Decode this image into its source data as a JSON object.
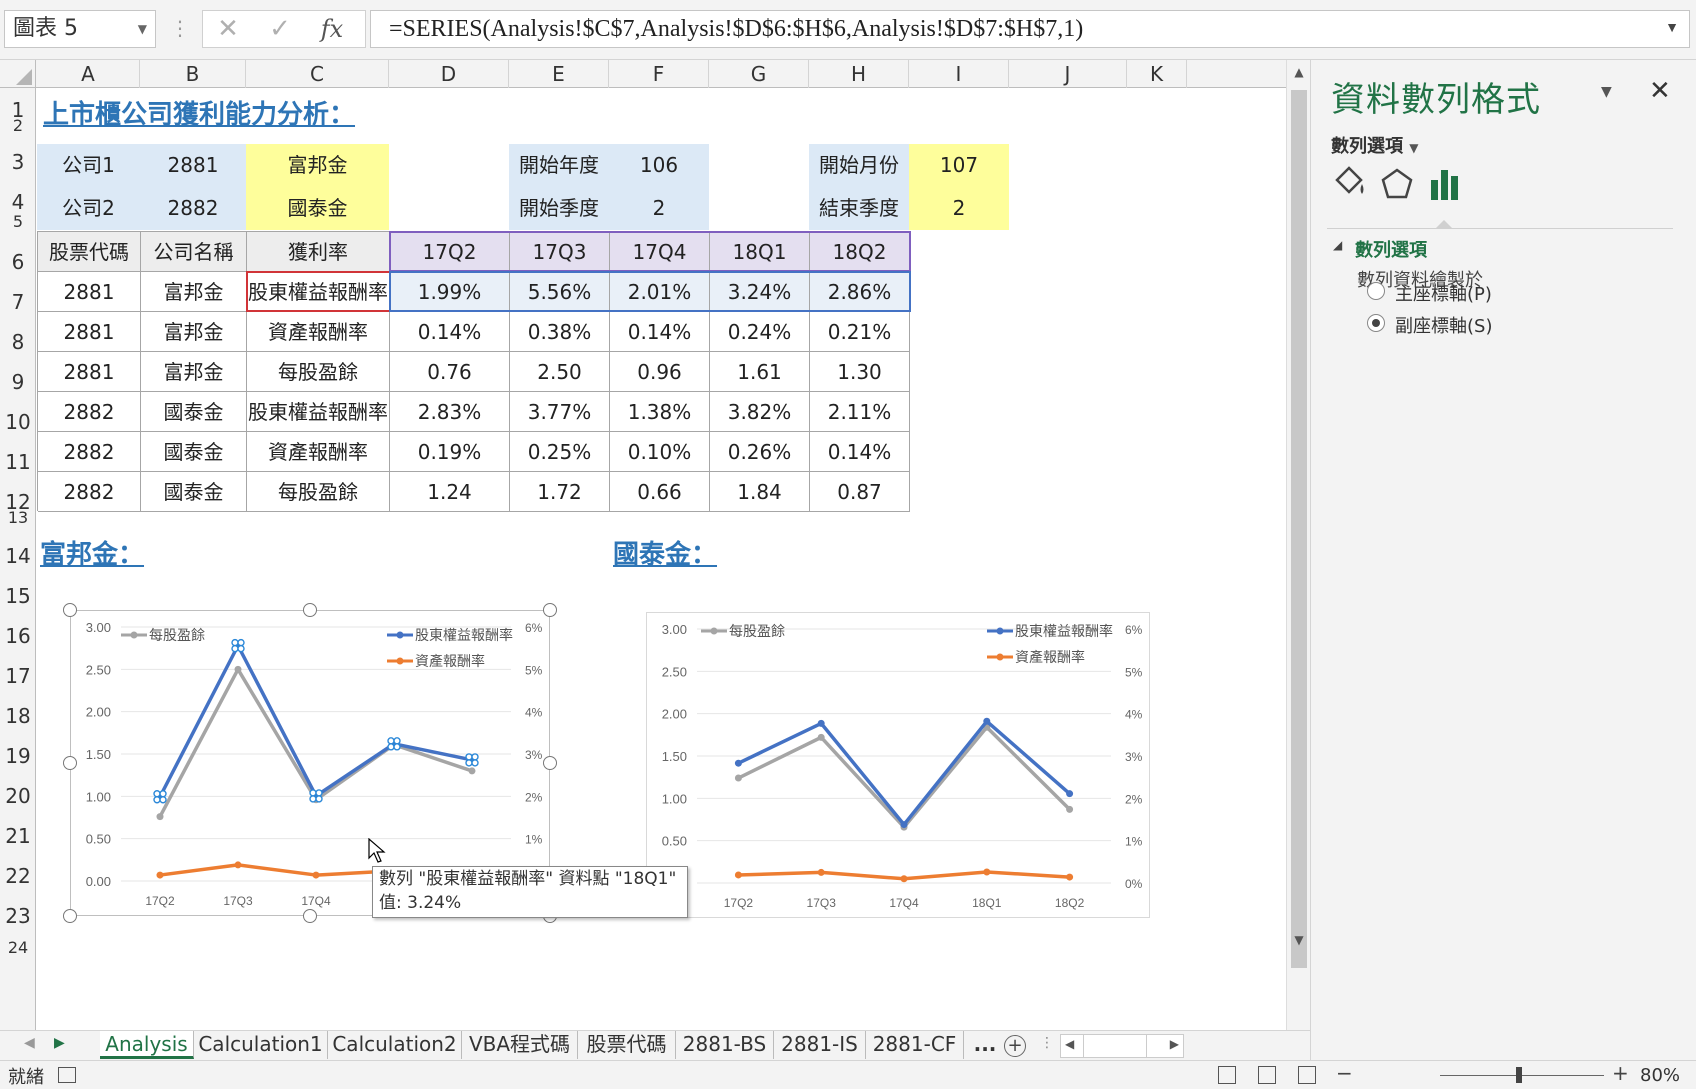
{
  "formula_bar": {
    "name_box": "圖表 5",
    "formula": "=SERIES(Analysis!$C$7,Analysis!$D$6:$H$6,Analysis!$D$7:$H$7,1)"
  },
  "columns": [
    "A",
    "B",
    "C",
    "D",
    "E",
    "F",
    "G",
    "H",
    "I",
    "J",
    "K"
  ],
  "rows": [
    "1",
    "2",
    "3",
    "4",
    "5",
    "6",
    "7",
    "8",
    "9",
    "10",
    "11",
    "12",
    "13",
    "14",
    "15",
    "16",
    "17",
    "18",
    "19",
    "20",
    "21",
    "22",
    "23",
    "24"
  ],
  "sheet": {
    "title": "上市櫃公司獲利能力分析：",
    "params": {
      "company1_label": "公司1",
      "company1_code": "2881",
      "company1_name": "富邦金",
      "company2_label": "公司2",
      "company2_code": "2882",
      "company2_name": "國泰金",
      "start_year_label": "開始年度",
      "start_year": "106",
      "start_quarter_label": "開始季度",
      "start_quarter": "2",
      "start_month_label": "開始月份",
      "start_month": "107",
      "end_quarter_label": "結束季度",
      "end_quarter": "2"
    },
    "table": {
      "headers": [
        "股票代碼",
        "公司名稱",
        "獲利率",
        "17Q2",
        "17Q3",
        "17Q4",
        "18Q1",
        "18Q2"
      ],
      "rows": [
        [
          "2881",
          "富邦金",
          "股東權益報酬率",
          "1.99%",
          "5.56%",
          "2.01%",
          "3.24%",
          "2.86%"
        ],
        [
          "2881",
          "富邦金",
          "資產報酬率",
          "0.14%",
          "0.38%",
          "0.14%",
          "0.24%",
          "0.21%"
        ],
        [
          "2881",
          "富邦金",
          "每股盈餘",
          "0.76",
          "2.50",
          "0.96",
          "1.61",
          "1.30"
        ],
        [
          "2882",
          "國泰金",
          "股東權益報酬率",
          "2.83%",
          "3.77%",
          "1.38%",
          "3.82%",
          "2.11%"
        ],
        [
          "2882",
          "國泰金",
          "資產報酬率",
          "0.19%",
          "0.25%",
          "0.10%",
          "0.26%",
          "0.14%"
        ],
        [
          "2882",
          "國泰金",
          "每股盈餘",
          "1.24",
          "1.72",
          "0.66",
          "1.84",
          "0.87"
        ]
      ]
    },
    "section1_title": "富邦金：",
    "section2_title": "國泰金："
  },
  "chart_data": [
    {
      "type": "line",
      "categories": [
        "17Q2",
        "17Q3",
        "17Q4",
        "18Q1",
        "18Q2"
      ],
      "ylim": [
        0,
        3
      ],
      "y_ticks": [
        "3.00",
        "2.50",
        "2.00",
        "1.50",
        "1.00",
        "0.50",
        "0.00"
      ],
      "y2lim": [
        0,
        6
      ],
      "y2_ticks": [
        "6%",
        "5%",
        "4%",
        "3%",
        "2%",
        "1%",
        "0%"
      ],
      "legend": [
        "每股盈餘",
        "股東權益報酬率",
        "資產報酬率"
      ],
      "series": [
        {
          "name": "每股盈餘",
          "axis": "primary",
          "color": "#a5a5a5",
          "values": [
            0.76,
            2.5,
            0.96,
            1.61,
            1.3
          ]
        },
        {
          "name": "股東權益報酬率",
          "axis": "secondary",
          "color": "#4472c4",
          "values": [
            1.99,
            5.56,
            2.01,
            3.24,
            2.86
          ]
        },
        {
          "name": "資產報酬率",
          "axis": "secondary",
          "color": "#ed7d31",
          "values": [
            0.14,
            0.38,
            0.14,
            0.24,
            0.21
          ]
        }
      ]
    },
    {
      "type": "line",
      "categories": [
        "17Q2",
        "17Q3",
        "17Q4",
        "18Q1",
        "18Q2"
      ],
      "ylim": [
        0,
        3
      ],
      "y_ticks": [
        "3.00",
        "2.50",
        "2.00",
        "1.50",
        "1.00",
        "0.50",
        "0.00"
      ],
      "y2lim": [
        0,
        6
      ],
      "y2_ticks": [
        "6%",
        "5%",
        "4%",
        "3%",
        "2%",
        "1%",
        "0%"
      ],
      "legend": [
        "每股盈餘",
        "股東權益報酬率",
        "資產報酬率"
      ],
      "series": [
        {
          "name": "每股盈餘",
          "axis": "primary",
          "color": "#a5a5a5",
          "values": [
            1.24,
            1.72,
            0.66,
            1.84,
            0.87
          ]
        },
        {
          "name": "股東權益報酬率",
          "axis": "secondary",
          "color": "#4472c4",
          "values": [
            2.83,
            3.77,
            1.38,
            3.82,
            2.11
          ]
        },
        {
          "name": "資產報酬率",
          "axis": "secondary",
          "color": "#ed7d31",
          "values": [
            0.19,
            0.25,
            0.1,
            0.26,
            0.14
          ]
        }
      ]
    }
  ],
  "tooltip": {
    "line1": "數列 \"股東權益報酬率\" 資料點 \"18Q1\"",
    "line2": "值: 3.24%"
  },
  "pane": {
    "title": "資料數列格式",
    "options_dropdown": "數列選項",
    "section_title": "數列選項",
    "plot_on_label": "數列資料繪製於",
    "primary_axis": "主座標軸(P)",
    "secondary_axis": "副座標軸(S)",
    "selected": "secondary"
  },
  "tabs": [
    "Analysis",
    "Calculation1",
    "Calculation2",
    "VBA程式碼",
    "股票代碼",
    "2881-BS",
    "2881-IS",
    "2881-CF",
    "..."
  ],
  "status": {
    "text": "就緒",
    "zoom": "80%"
  },
  "colors": {
    "accent": "#217346",
    "title_blue": "#2e75b6",
    "series_blue": "#4472c4",
    "series_orange": "#ed7d31",
    "series_gray": "#a5a5a5"
  }
}
